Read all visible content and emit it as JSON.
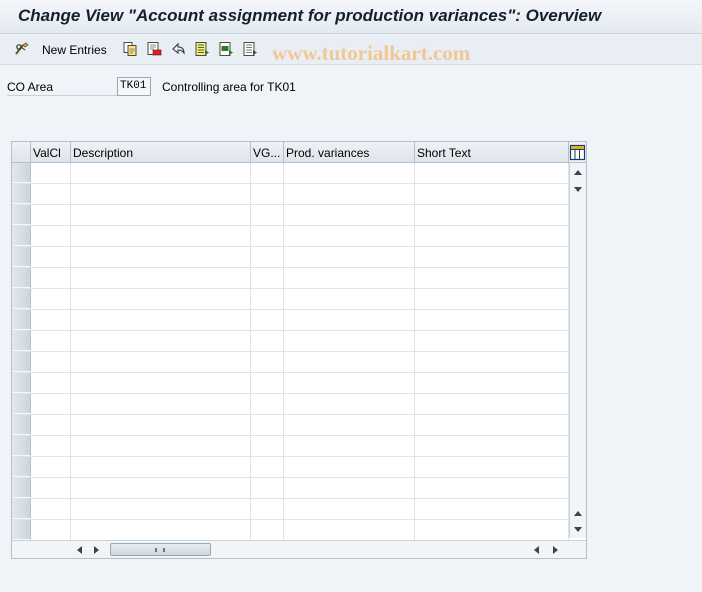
{
  "window": {
    "title": "Change View \"Account assignment for production variances\": Overview"
  },
  "toolbar": {
    "new_entries_label": "New Entries",
    "watermark": "www.tutorialkart.com",
    "icons": [
      "glasses-edit-icon",
      "copy-icon",
      "delete-icon",
      "undo-icon",
      "select-all-icon",
      "select-block-icon",
      "deselect-all-icon"
    ]
  },
  "fields": {
    "co_area_label": "CO Area",
    "co_area_value": "TK01",
    "co_area_desc": "Controlling area for TK01"
  },
  "table": {
    "columns": [
      {
        "key": "valcl",
        "label": "ValCl"
      },
      {
        "key": "description",
        "label": "Description"
      },
      {
        "key": "vg",
        "label": "VG..."
      },
      {
        "key": "prod_variances",
        "label": "Prod. variances"
      },
      {
        "key": "short_text",
        "label": "Short Text"
      }
    ],
    "row_count": 18
  },
  "colors": {
    "background": "#f0f4f8",
    "title_text": "#12202f",
    "watermark": "#f0c896",
    "grid_border": "#b5c0cb"
  }
}
